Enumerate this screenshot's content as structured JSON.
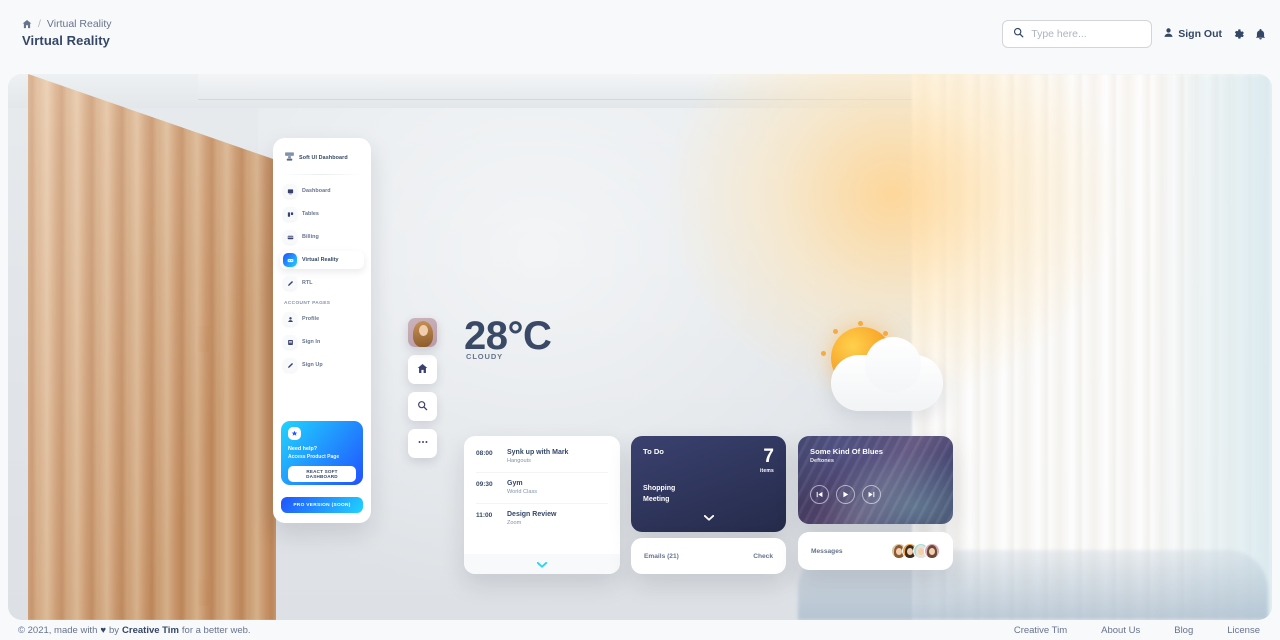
{
  "topnav": {
    "breadcrumb": {
      "home_icon": "home-icon",
      "separator": "/",
      "current": "Virtual Reality"
    },
    "page_title": "Virtual Reality",
    "search": {
      "placeholder": "Type here...",
      "value": "",
      "icon": "search-icon"
    },
    "sign_out": "Sign Out",
    "icons": {
      "user": "user-icon",
      "settings": "gear-icon",
      "notifications": "bell-icon"
    }
  },
  "sidebar": {
    "brand": "Soft UI Dashboard",
    "brand_icon": "soft-ui-logo-icon",
    "items": [
      {
        "label": "Dashboard",
        "icon": "dashboard-icon",
        "active": false
      },
      {
        "label": "Tables",
        "icon": "tables-icon",
        "active": false
      },
      {
        "label": "Billing",
        "icon": "billing-icon",
        "active": false
      },
      {
        "label": "Virtual Reality",
        "icon": "vr-icon",
        "active": true
      },
      {
        "label": "RTL",
        "icon": "rtl-icon",
        "active": false
      }
    ],
    "section_label": "ACCOUNT PAGES",
    "account_items": [
      {
        "label": "Profile",
        "icon": "profile-icon"
      },
      {
        "label": "Sign In",
        "icon": "sign-in-icon"
      },
      {
        "label": "Sign Up",
        "icon": "sign-up-icon"
      }
    ],
    "promo": {
      "badge_icon": "star-icon",
      "title": "Need help?",
      "subtitle": "Access Product Page",
      "button": "REACT SOFT DASHBOARD"
    },
    "pro_button": "PRO VERSION (SOON)"
  },
  "tool_column": {
    "avatar": "user-avatar",
    "buttons": [
      {
        "icon": "home-icon",
        "name": "home-button"
      },
      {
        "icon": "search-icon",
        "name": "search-button"
      },
      {
        "icon": "more-icon",
        "name": "more-button"
      }
    ]
  },
  "weather": {
    "temperature": "28°C",
    "condition": "CLOUDY",
    "icon": "sun-behind-cloud-icon"
  },
  "schedule": {
    "events": [
      {
        "time": "08:00",
        "title": "Synk up with Mark",
        "subtitle": "Hangouts"
      },
      {
        "time": "09:30",
        "title": "Gym",
        "subtitle": "World Class"
      },
      {
        "time": "11:00",
        "title": "Design Review",
        "subtitle": "Zoom"
      }
    ],
    "expand_icon": "chevron-down-icon"
  },
  "todo": {
    "title": "To Do",
    "count": "7",
    "count_label": "items",
    "entries": [
      "Shopping",
      "Meeting"
    ],
    "expand_icon": "chevron-down-icon"
  },
  "emails": {
    "label": "Emails (21)",
    "action": "Check"
  },
  "music": {
    "title": "Some Kind Of Blues",
    "artist": "Deftones",
    "controls": [
      {
        "icon": "skip-back-icon",
        "name": "previous-track-button"
      },
      {
        "icon": "play-icon",
        "name": "play-button"
      },
      {
        "icon": "skip-forward-icon",
        "name": "next-track-button"
      }
    ]
  },
  "messages": {
    "label": "Messages",
    "avatars": [
      "avatar-1",
      "avatar-2",
      "avatar-3",
      "avatar-4"
    ]
  },
  "footer": {
    "copyright_pre": "© 2021, made with",
    "heart": "♥",
    "by": "by",
    "brand": "Creative Tim",
    "copyright_post": "for a better web.",
    "links": [
      {
        "label": "Creative Tim"
      },
      {
        "label": "About Us"
      },
      {
        "label": "Blog"
      },
      {
        "label": "License"
      }
    ]
  },
  "colors": {
    "accent_cyan": "#21d4fd",
    "accent_blue": "#2152ff",
    "text_dark": "#344767",
    "text_muted": "#67748e",
    "todo_card": "#3a416f"
  }
}
